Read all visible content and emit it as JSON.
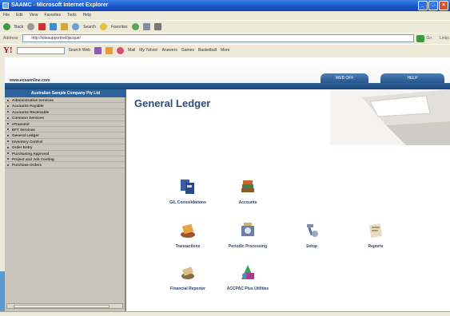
{
  "window": {
    "title": "SAAMC - Microsoft Internet Explorer"
  },
  "menubar": [
    "File",
    "Edit",
    "View",
    "Favorites",
    "Tools",
    "Help"
  ],
  "toolbar": {
    "back": "Back",
    "search": "Search",
    "favorites": "Favorites"
  },
  "address": {
    "label": "Address",
    "value": "http://sitesupportnet/jacque/",
    "go": "Go",
    "links": "Links"
  },
  "yahoo": {
    "search_web": "Search Web",
    "mail": "Mail",
    "my_yahoo": "My Yahoo!",
    "answers": "Answers",
    "games": "Games",
    "basketball": "Basketball",
    "more": "More"
  },
  "site": {
    "url": "www.ecsaonline.com",
    "tab1": "WEB OFF",
    "tab2": "HELP",
    "company": "Australian Sample Company Pty Ltd"
  },
  "sidebar": {
    "items": [
      "Administrative Services",
      "Accounts Payable",
      "Accounts Receivable",
      "Common Services",
      "eTransmit",
      "EFT Services",
      "General Ledger",
      "Inventory Control",
      "Order Entry",
      "Purchasing Approval",
      "Project and Job Costing",
      "Purchase Orders"
    ]
  },
  "main": {
    "title": "General Ledger",
    "tiles": [
      {
        "label": "G/L Consolidations",
        "icon": "consolidations-icon"
      },
      {
        "label": "Accounts",
        "icon": "accounts-books-icon"
      },
      {
        "label": "Transactions",
        "icon": "transactions-icon"
      },
      {
        "label": "Periodic Processing",
        "icon": "periodic-processing-icon"
      },
      {
        "label": "Setup",
        "icon": "setup-tools-icon"
      },
      {
        "label": "Reports",
        "icon": "reports-icon"
      },
      {
        "label": "Financial Reporter",
        "icon": "financial-reporter-icon"
      },
      {
        "label": "ACCPAC Plus Utilities",
        "icon": "utilities-icon"
      }
    ]
  },
  "colors": {
    "xp_blue": "#1a56c8",
    "banner_blue": "#2c5f97",
    "sidebar_bg": "#c9c5bc",
    "title_blue": "#2a4d7a"
  }
}
